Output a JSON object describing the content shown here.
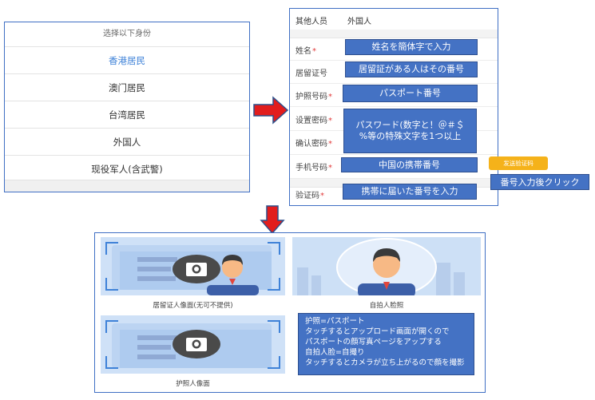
{
  "identity_selector": {
    "title": "选择以下身份",
    "options": [
      {
        "label": "香港居民",
        "selected": true
      },
      {
        "label": "澳门居民",
        "selected": false
      },
      {
        "label": "台湾居民",
        "selected": false
      },
      {
        "label": "外国人",
        "selected": false
      },
      {
        "label": "现役军人(含武警)",
        "selected": false
      }
    ]
  },
  "form": {
    "tab_other": "其他人员",
    "tab_foreigner": "外国人",
    "labels": {
      "name": "姓名",
      "residence_permit": "居留证号",
      "passport": "护照号码",
      "set_password": "设置密码",
      "confirm_password": "确认密码",
      "phone": "手机号码",
      "verify_code": "验证码"
    },
    "required_mark": "*",
    "overlays": {
      "name": "姓名を簡体字で入力",
      "residence_permit": "居留証がある人はその番号",
      "passport": "パスポート番号",
      "password": "パスワード(数字と！＠＃＄\n%等の特殊文字を1つ以上",
      "phone": "中国の携帯番号",
      "verify_code": "携帯に届いた番号を入力"
    },
    "send_code_button": "发送验证码",
    "after_input_note": "番号入力後クリック"
  },
  "photos": {
    "residence_caption": "居留证人像面(无可不提供)",
    "selfie_caption": "自拍人脸照",
    "passport_caption": "护照人像面",
    "note_lines": [
      "护照=パスポート",
      "タッチするとアップロード画面が開くので",
      "パスポートの顔写真ページをアップする",
      "自拍人脸=自撮り",
      "タッチするとカメラが立ち上がるので顔を撮影"
    ]
  },
  "colors": {
    "accent_blue": "#4472c4",
    "panel_border": "#3f6fc4",
    "selected_text": "#3f82d8",
    "required": "#e23b3b",
    "send_button": "#f5b21a",
    "arrow_red": "#e21d1d"
  }
}
